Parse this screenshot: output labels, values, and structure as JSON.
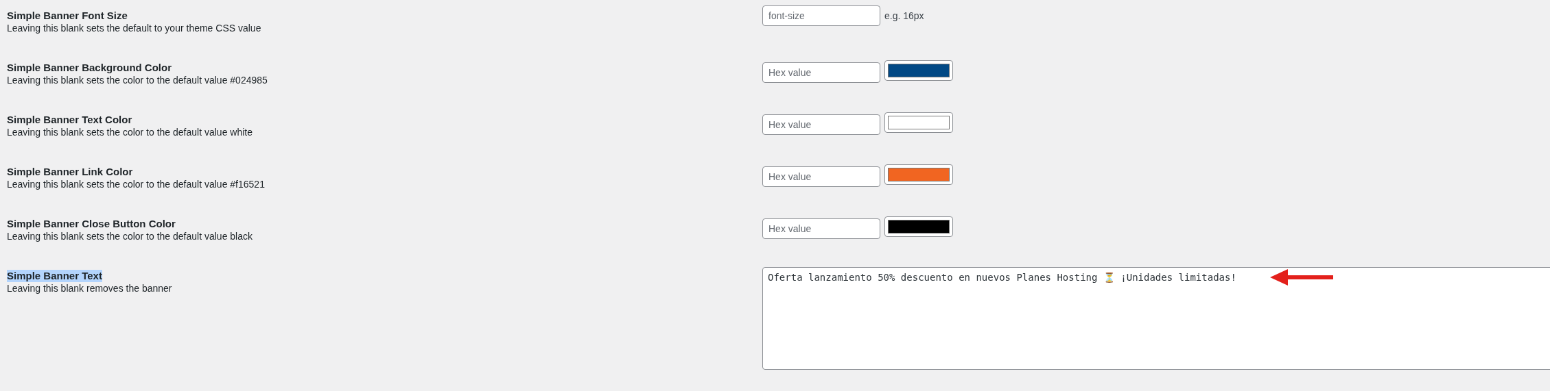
{
  "settings": [
    {
      "kind": "text_input",
      "title": "Simple Banner Font Size",
      "description": "Leaving this blank sets the default to your theme CSS value",
      "placeholder": "font-size",
      "hint": "e.g. 16px"
    },
    {
      "kind": "color_input",
      "title": "Simple Banner Background Color",
      "description": "Leaving this blank sets the color to the default value #024985",
      "placeholder": "Hex value",
      "color": "#024985"
    },
    {
      "kind": "color_input",
      "title": "Simple Banner Text Color",
      "description": "Leaving this blank sets the color to the default value white",
      "placeholder": "Hex value",
      "color": "#ffffff"
    },
    {
      "kind": "color_input",
      "title": "Simple Banner Link Color",
      "description": "Leaving this blank sets the color to the default value #f16521",
      "placeholder": "Hex value",
      "color": "#f16521"
    },
    {
      "kind": "color_input",
      "title": "Simple Banner Close Button Color",
      "description": "Leaving this blank sets the color to the default value black",
      "placeholder": "Hex value",
      "color": "#000000"
    },
    {
      "kind": "textarea",
      "title": "Simple Banner Text",
      "title_highlighted": true,
      "description": "Leaving this blank removes the banner",
      "value": "Oferta lanzamiento 50% descuento en nuevos Planes Hosting ⏳ ¡Unidades limitadas!",
      "annotated": true
    }
  ]
}
